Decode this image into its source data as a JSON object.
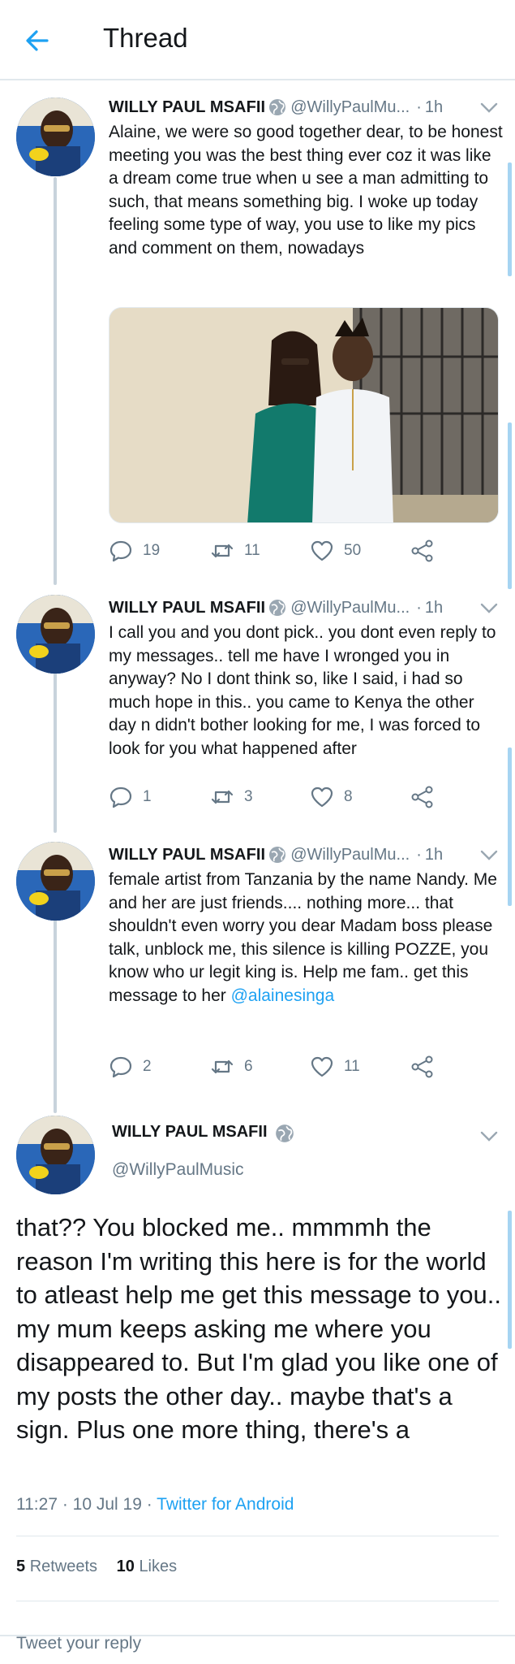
{
  "header": {
    "title": "Thread",
    "back_icon": "arrow-left-icon"
  },
  "colors": {
    "accent": "#1da1f2",
    "secondary_text": "#657786",
    "text": "#14171a",
    "divider": "#e1e8ed"
  },
  "replies": [
    {
      "name": "WILLY PAUL MSAFII",
      "handle": "@WillyPaulMu...",
      "time": "1h",
      "text": "Alaine, we were so good together dear, to be honest meeting you was the best thing ever coz it was like a dream come true when u see a man admitting to such, that means something big. I woke up today feeling some type of way, you use to like my pics and comment on them, nowadays",
      "replies": "19",
      "retweets": "11",
      "likes": "50"
    },
    {
      "name": "WILLY PAUL MSAFII",
      "handle": "@WillyPaulMu...",
      "time": "1h",
      "text": "I call you and you dont pick.. you dont even reply to my messages.. tell me have I wronged you in anyway? No I dont think so, like I said, i had so much hope in this.. you came to Kenya the other day n didn't bother looking for me, I was forced to look for you what happened after",
      "replies": "1",
      "retweets": "3",
      "likes": "8"
    },
    {
      "name": "WILLY PAUL MSAFII",
      "handle": "@WillyPaulMu...",
      "time": "1h",
      "text": "female artist from Tanzania by the name Nandy. Me and her are just friends.... nothing more... that shouldn't even worry you dear Madam boss please talk, unblock me, this silence is killing POZZE, you know who ur legit king is. Help me fam.. get this message to her ",
      "mention": "@alainesinga",
      "replies": "2",
      "retweets": "6",
      "likes": "11"
    }
  ],
  "main_tweet": {
    "name": "WILLY PAUL MSAFII",
    "handle": "@WillyPaulMusic",
    "text": "that?? You blocked me.. mmmmh the reason I'm writing this here is for the world to atleast help me get this message to you.. my mum keeps asking me where you disappeared to. But I'm glad you like one of my posts the other day.. maybe that's a sign. Plus one more thing, there's a",
    "timestamp": "11:27 · 10 Jul 19 · ",
    "source": "Twitter for Android",
    "retweets_count": "5",
    "retweets_label": "Retweets",
    "likes_count": "10",
    "likes_label": "Likes"
  },
  "reply_box": {
    "placeholder": "Tweet your reply"
  }
}
